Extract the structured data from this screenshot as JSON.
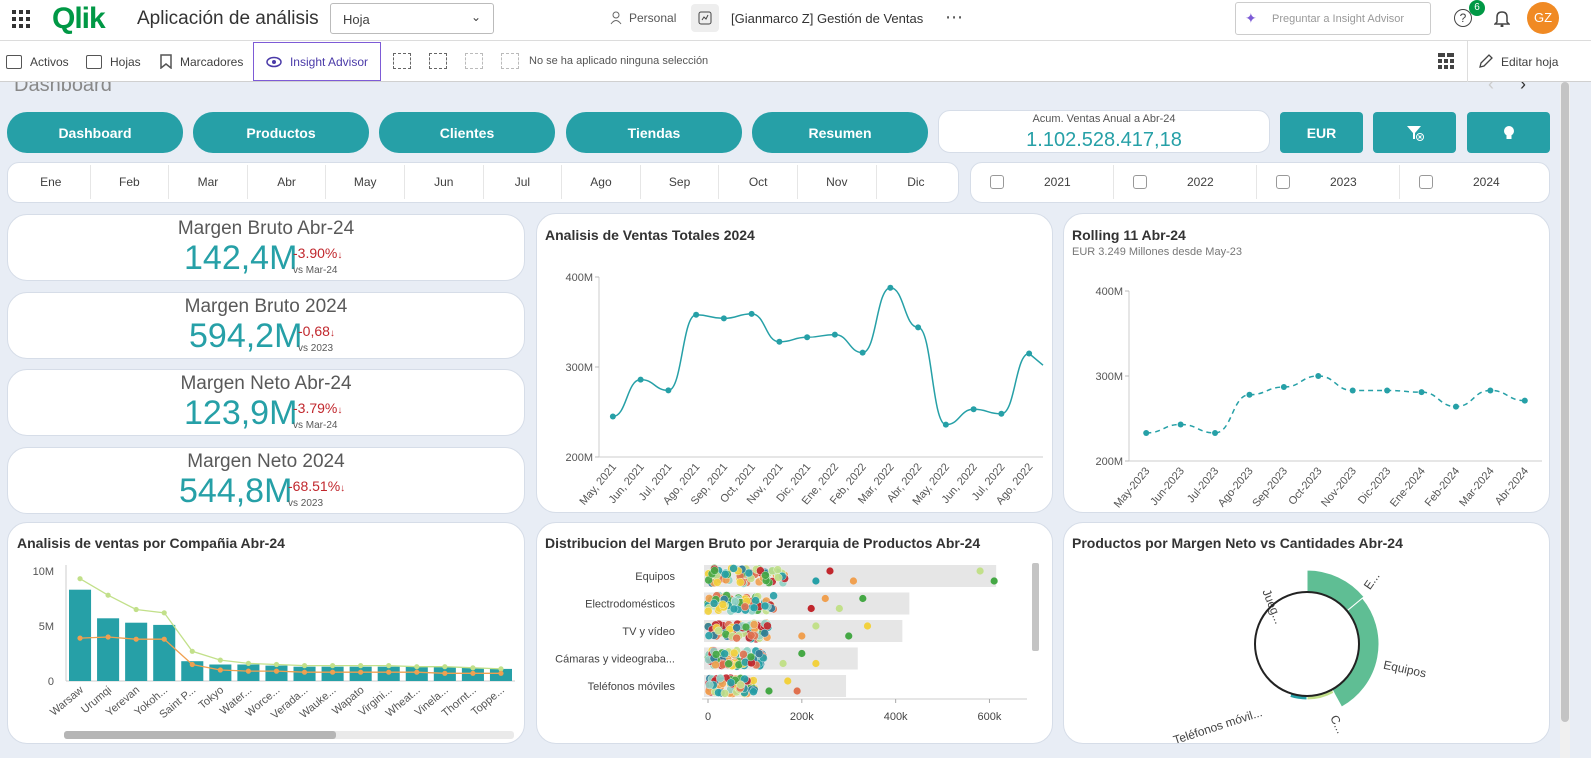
{
  "app": {
    "logo": "Qlik",
    "title": "Aplicación de análisis",
    "sheet_select": "Hoja",
    "space": "Personal",
    "app_name": "[Gianmarco Z] Gestión de Ventas",
    "more": "⋯",
    "search_placeholder": "Preguntar a Insight Advisor",
    "help_badge": "6",
    "avatar": "GZ"
  },
  "toolbar": {
    "activos": "Activos",
    "hojas": "Hojas",
    "marcadores": "Marcadores",
    "insight": "Insight Advisor",
    "selection": "No se ha aplicado ninguna selección",
    "edit": "Editar hoja"
  },
  "sheet_title": "Dashboard",
  "nav": [
    "Dashboard",
    "Productos",
    "Clientes",
    "Tiendas",
    "Resumen"
  ],
  "acum": {
    "label": "Acum. Ventas Anual a Abr-24",
    "value": "1.102.528.417,18"
  },
  "currency_button": "EUR",
  "months": [
    "Ene",
    "Feb",
    "Mar",
    "Abr",
    "May",
    "Jun",
    "Jul",
    "Ago",
    "Sep",
    "Oct",
    "Nov",
    "Dic"
  ],
  "years": [
    "2021",
    "2022",
    "2023",
    "2024"
  ],
  "kpis": [
    {
      "title": "Margen Bruto Abr-24",
      "value": "142,4M",
      "delta": "-3.90%",
      "arrow": "↓",
      "sub": "vs Mar-24"
    },
    {
      "title": "Margen Bruto 2024",
      "value": "594,2M",
      "delta": "-0,68",
      "arrow": "↓",
      "sub": "vs 2023"
    },
    {
      "title": "Margen Neto Abr-24",
      "value": "123,9M",
      "delta": "-3.79%",
      "arrow": "↓",
      "sub": "vs Mar-24"
    },
    {
      "title": "Margen Neto 2024",
      "value": "544,8M",
      "delta": "-68.51%",
      "arrow": "↓",
      "sub": "vs 2023"
    }
  ],
  "colors": {
    "accent": "#26a0a7",
    "negative": "#c1272d",
    "line2": "#c2e08a",
    "orange": "#f0a050"
  },
  "chart_data": [
    {
      "type": "line",
      "title": "Analisis de Ventas Totales 2024",
      "x": [
        "May, 2021",
        "Jun, 2021",
        "Jul, 2021",
        "Ago, 2021",
        "Sep, 2021",
        "Oct, 2021",
        "Nov, 2021",
        "Dic, 2021",
        "Ene, 2022",
        "Feb, 2022",
        "Mar, 2022",
        "Abr, 2022",
        "May, 2022",
        "Jun, 2022",
        "Jul, 2022",
        "Ago, 2022"
      ],
      "values": [
        245,
        286,
        274,
        358,
        354,
        359,
        328,
        333,
        336,
        316,
        388,
        344,
        236,
        253,
        248,
        315
      ],
      "yticks": [
        "200M",
        "300M",
        "400M"
      ],
      "ylim": [
        200,
        400
      ]
    },
    {
      "type": "line",
      "title": "Rolling 11 Abr-24",
      "subtitle": "EUR 3.249 Millones desde May-23",
      "x": [
        "May-2023",
        "Jun-2023",
        "Jul-2023",
        "Ago-2023",
        "Sep-2023",
        "Oct-2023",
        "Nov-2023",
        "Dic-2023",
        "Ene-2024",
        "Feb-2024",
        "Mar-2024",
        "Abr-2024"
      ],
      "values": [
        233,
        243,
        233,
        278,
        287,
        300,
        283,
        283,
        281,
        264,
        283,
        271
      ],
      "yticks": [
        "200M",
        "300M",
        "400M"
      ],
      "ylim": [
        200,
        400
      ]
    },
    {
      "type": "bar",
      "title": "Analisis de ventas por Compañia Abr-24",
      "categories": [
        "Warsaw",
        "Urumqi",
        "Yerevan",
        "Yokoh...",
        "Saint P...",
        "Tokyo",
        "Water...",
        "Worce...",
        "Verada...",
        "Wauke...",
        "Wapato",
        "Virgini...",
        "Wheat...",
        "Vinela...",
        "Thornt...",
        "Toppe..."
      ],
      "values": [
        8.3,
        5.7,
        5.3,
        5.1,
        1.8,
        1.5,
        1.5,
        1.4,
        1.3,
        1.3,
        1.3,
        1.3,
        1.3,
        1.3,
        1.2,
        1.1
      ],
      "line_values": [
        9.3,
        7.8,
        6.5,
        6.2,
        2.7,
        1.9,
        1.6,
        1.5,
        1.4,
        1.4,
        1.4,
        1.4,
        1.3,
        1.3,
        1.2,
        1.1
      ],
      "line2_values": [
        3.9,
        4.0,
        3.8,
        3.8,
        1.5,
        1.0,
        0.9,
        0.9,
        0.8,
        0.8,
        0.8,
        0.8,
        0.8,
        0.7,
        0.7,
        0.7
      ],
      "yticks": [
        "0",
        "5M",
        "10M"
      ],
      "ylim": [
        0,
        10
      ]
    },
    {
      "type": "scatter",
      "title": "Distribucion del Margen Bruto por Jerarquia de Productos Abr-24",
      "categories": [
        "Equipos",
        "Electrodomésticos",
        "TV y vídeo",
        "Cámaras y videograba...",
        "Teléfonos móviles"
      ],
      "range_max": [
        610,
        425,
        410,
        315,
        290
      ],
      "dense_max": [
        165,
        140,
        130,
        120,
        100
      ],
      "outliers": [
        [
          230,
          260,
          310,
          580,
          610
        ],
        [
          220,
          250,
          280,
          330
        ],
        [
          200,
          230,
          300,
          340
        ],
        [
          160,
          200,
          230
        ],
        [
          130,
          170,
          190
        ]
      ],
      "xticks": [
        "0",
        "200k",
        "400k",
        "600k"
      ],
      "xlim": [
        0,
        680
      ]
    },
    {
      "type": "pie",
      "title": "Productos por Margen Neto vs Cantidades Abr-24",
      "slices": [
        {
          "label": "E...",
          "value": 14
        },
        {
          "label": "Equipos",
          "value": 28
        },
        {
          "label": "C...",
          "value": 8
        },
        {
          "label": "Teléfonos móvil...",
          "value": 5
        },
        {
          "label": "Jueg...",
          "value": 45
        }
      ]
    }
  ]
}
